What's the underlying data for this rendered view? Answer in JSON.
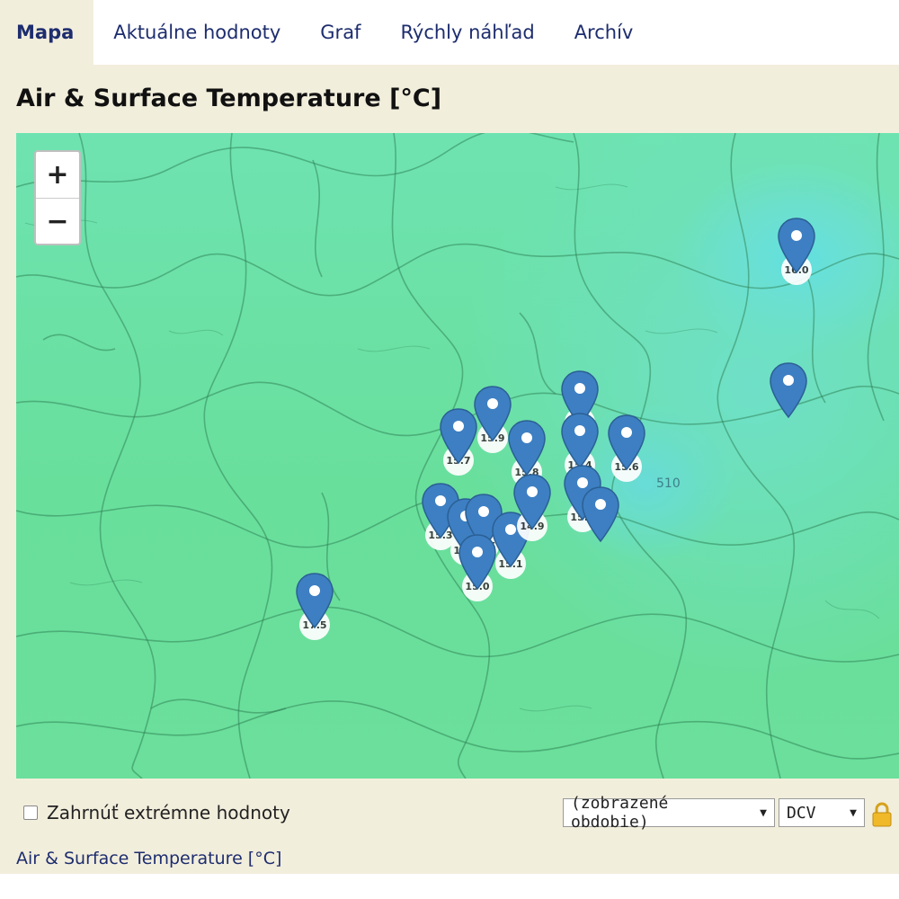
{
  "tabs": [
    {
      "label": "Mapa",
      "active": true
    },
    {
      "label": "Aktuálne hodnoty",
      "active": false
    },
    {
      "label": "Graf",
      "active": false
    },
    {
      "label": "Rýchly náhľad",
      "active": false
    },
    {
      "label": "Archív",
      "active": false
    }
  ],
  "page_title": "Air & Surface Temperature [°C]",
  "map": {
    "zoom_in_label": "+",
    "zoom_out_label": "−",
    "marker_color": "#3d7fc2",
    "stations": [
      {
        "value": "15.7"
      },
      {
        "value": "15.9"
      },
      {
        "value": "15.8"
      },
      {
        "value": "16.1"
      },
      {
        "value": "15.6"
      },
      {
        "value": "15.4"
      },
      {
        "value": "15.3"
      },
      {
        "value": "15.2"
      },
      {
        "value": "15.5"
      },
      {
        "value": "15.1"
      },
      {
        "value": "15.0"
      },
      {
        "value": "14.9"
      },
      {
        "value": "15.7"
      },
      {
        "value": "14.6"
      },
      {
        "value": "17.5"
      },
      {
        "value": "16.0"
      }
    ],
    "place_label": "510"
  },
  "controls": {
    "include_extremes_label": "Zahrnúť extrémne hodnoty",
    "include_extremes_checked": false,
    "period_select": "(zobrazené obdobie)",
    "aggregation_select": "DCV"
  },
  "footer_link": "Air & Surface Temperature [°C]"
}
